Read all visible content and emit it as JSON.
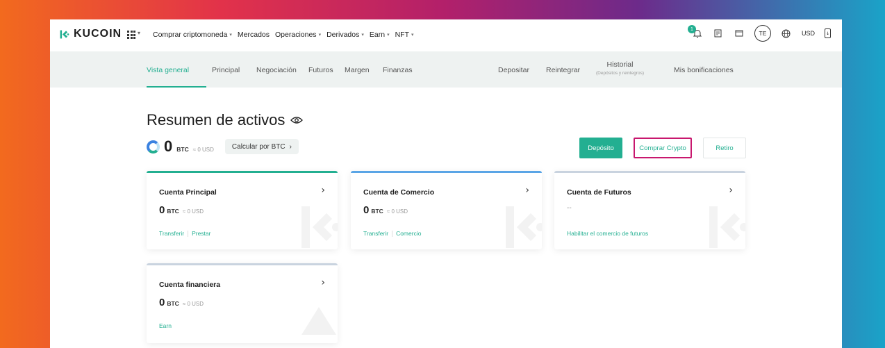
{
  "brand": {
    "name": "KUCOIN",
    "accent": "#23af91",
    "highlight": "#c8176e"
  },
  "topnav": {
    "menu": [
      {
        "label": "Comprar criptomoneda",
        "dropdown": true
      },
      {
        "label": "Mercados",
        "dropdown": false
      },
      {
        "label": "Operaciones",
        "dropdown": true
      },
      {
        "label": "Derivados",
        "dropdown": true
      },
      {
        "label": "Earn",
        "dropdown": true
      },
      {
        "label": "NFT",
        "dropdown": true
      }
    ],
    "notification_count": "1",
    "avatar_initials": "TE",
    "currency": "USD"
  },
  "subnav": {
    "tabs": [
      {
        "label": "Vista general",
        "active": true
      },
      {
        "label": "Principal"
      },
      {
        "label": "Negociación"
      },
      {
        "label": "Futuros"
      },
      {
        "label": "Margen"
      },
      {
        "label": "Finanzas"
      }
    ],
    "right": [
      "Depositar",
      "Reintegrar"
    ],
    "historial": {
      "label": "Historial",
      "sub": "(Depósitos y reintegros)"
    },
    "bonus": "Mis bonificaciones"
  },
  "summary": {
    "title": "Resumen de activos",
    "balance": "0",
    "unit": "BTC",
    "usd": "≈ 0 USD",
    "calc_label": "Calcular por BTC"
  },
  "actions": {
    "deposit": "Depósito",
    "buy": "Comprar Crypto",
    "withdraw": "Retiro"
  },
  "cards": [
    {
      "title": "Cuenta Principal",
      "balance": "0",
      "unit": "BTC",
      "usd": "≈ 0 USD",
      "links": [
        "Transferir",
        "Prestar"
      ],
      "color": "#23af91"
    },
    {
      "title": "Cuenta de Comercio",
      "balance": "0",
      "unit": "BTC",
      "usd": "≈ 0 USD",
      "links": [
        "Transferir",
        "Comercio"
      ],
      "color": "#5aa5e6"
    },
    {
      "title": "Cuenta de Futuros",
      "placeholder": "--",
      "links": [
        "Habilitar el comercio de futuros"
      ],
      "color": "#c9d3df"
    },
    {
      "title": "Cuenta financiera",
      "balance": "0",
      "unit": "BTC",
      "usd": "≈ 0 USD",
      "links": [
        "Earn"
      ],
      "color": "#c9d3df"
    }
  ]
}
